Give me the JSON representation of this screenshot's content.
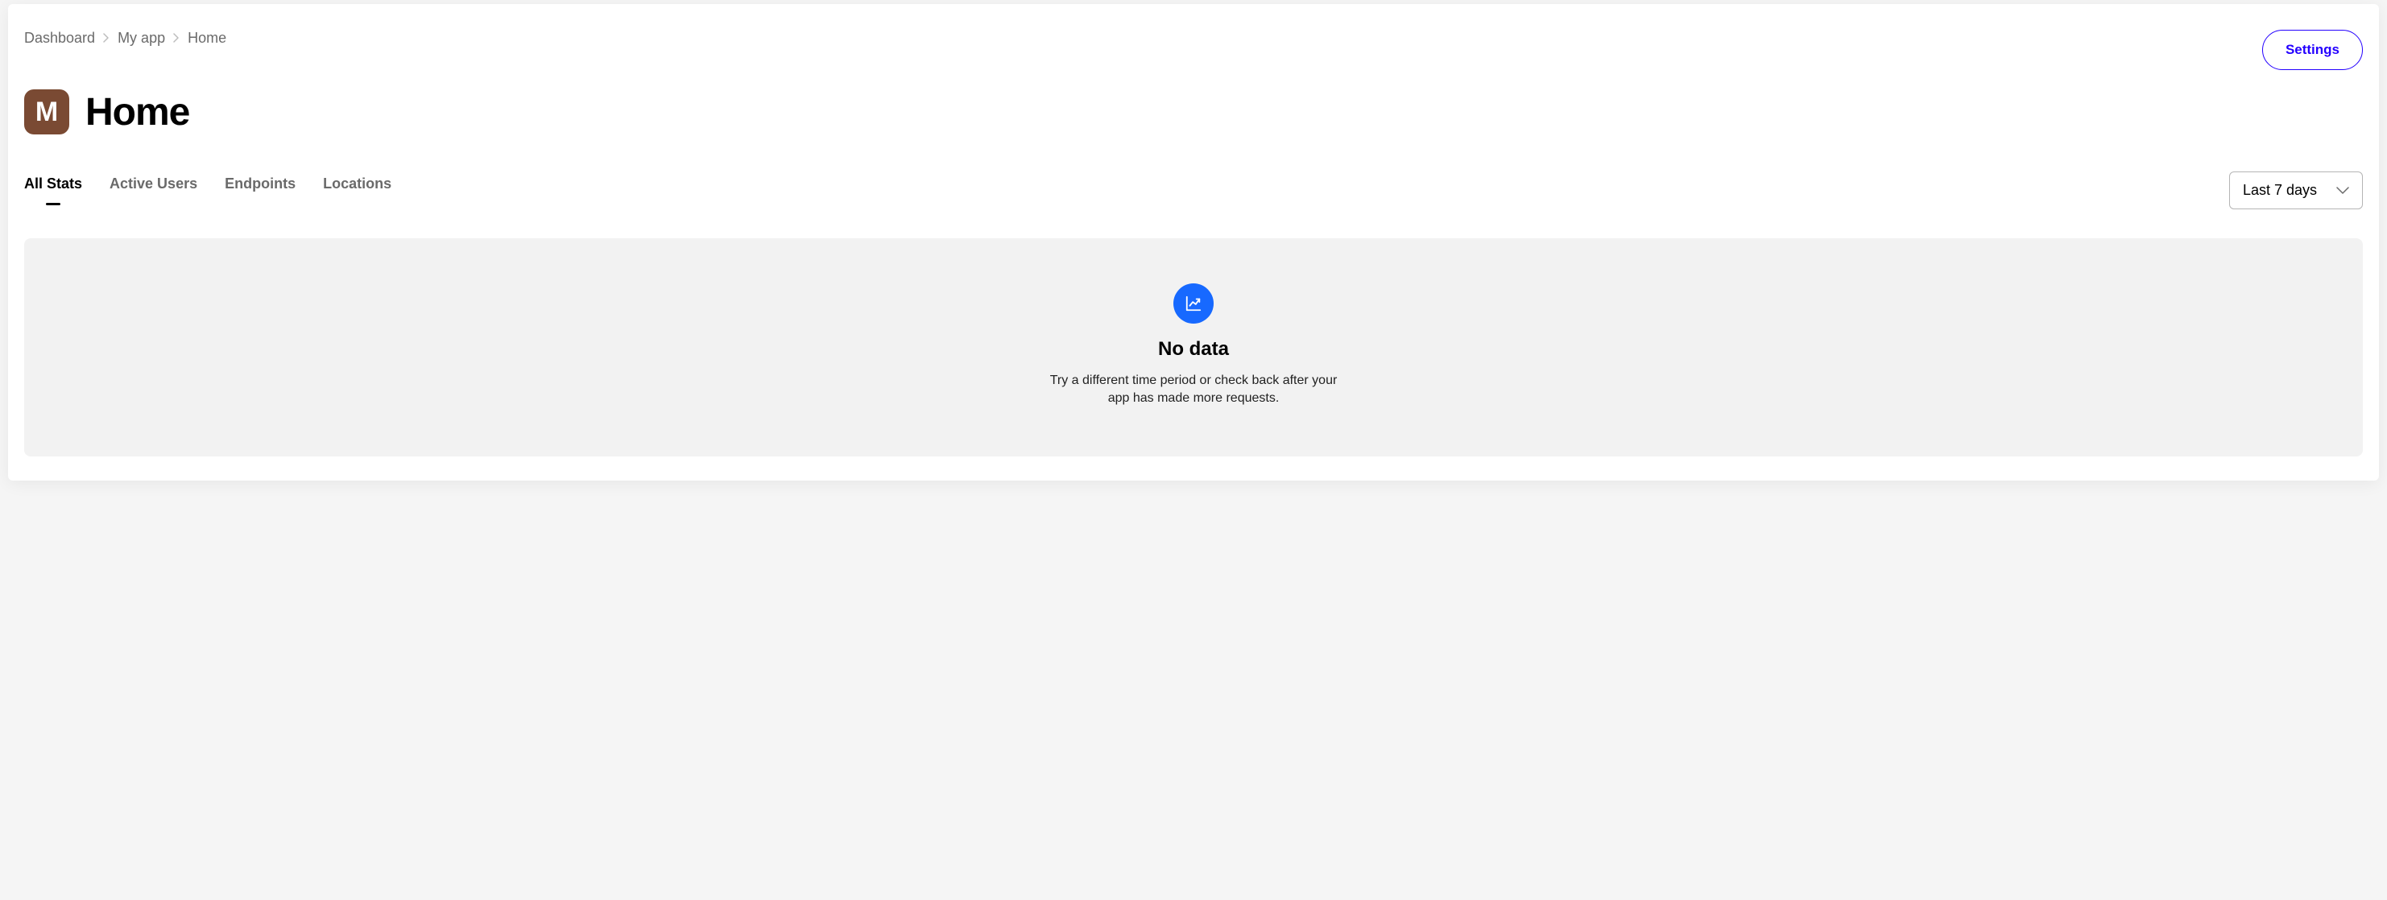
{
  "breadcrumbs": {
    "items": [
      "Dashboard",
      "My app",
      "Home"
    ]
  },
  "header": {
    "settings_label": "Settings",
    "app_initial": "M",
    "page_title": "Home"
  },
  "tabs": {
    "items": [
      "All Stats",
      "Active Users",
      "Endpoints",
      "Locations"
    ],
    "active_index": 0
  },
  "period": {
    "selected": "Last 7 days"
  },
  "empty_state": {
    "title": "No data",
    "message": "Try a different time period or check back after your app has made more requests."
  }
}
